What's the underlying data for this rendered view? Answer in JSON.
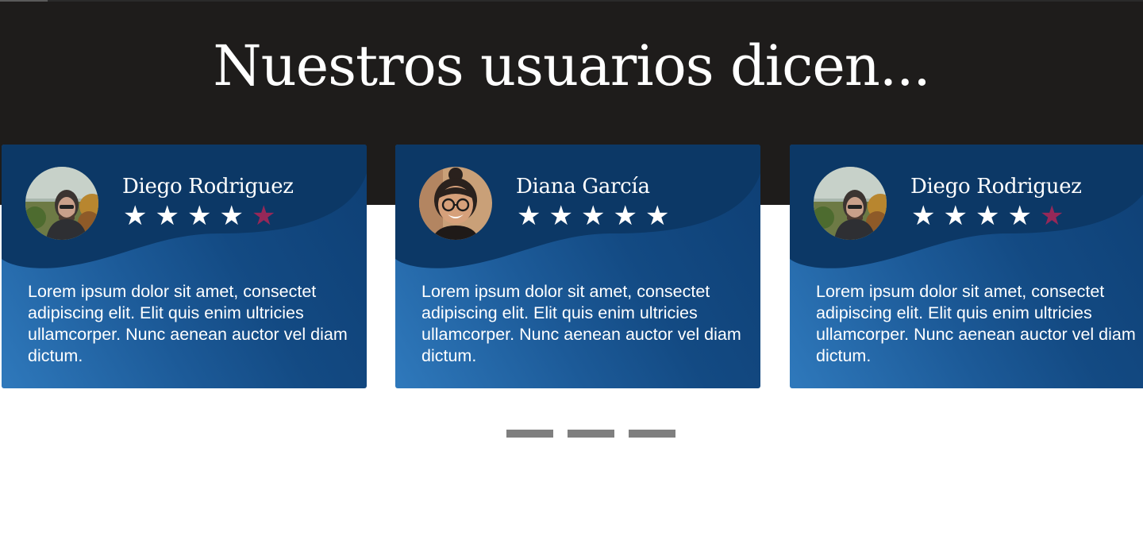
{
  "section": {
    "title": "Nuestros usuarios dicen..."
  },
  "testimonials": [
    {
      "name": "Diego Rodriguez",
      "rating": 4,
      "max_rating": 5,
      "text": "Lorem ipsum dolor sit amet, consectet adipiscing elit. Elit quis enim ultricies ullamcorper. Nunc aenean auctor vel diam dictum."
    },
    {
      "name": "Diana García",
      "rating": 5,
      "max_rating": 5,
      "text": "Lorem ipsum dolor sit amet, consectet adipiscing elit. Elit quis enim ultricies ullamcorper. Nunc aenean auctor vel diam dictum."
    },
    {
      "name": "Diego Rodriguez",
      "rating": 4,
      "max_rating": 5,
      "text": "Lorem ipsum dolor sit amet, consectet adipiscing elit. Elit quis enim ultricies ullamcorper. Nunc aenean auctor vel diam dictum."
    }
  ],
  "pagination": {
    "count": 3
  },
  "colors": {
    "header_background": "#1e1c1b",
    "card_gradient_light": "#2f79bc",
    "card_gradient_dark": "#0e3f74",
    "star_filled": "#ffffff",
    "star_empty": "#962858",
    "pager": "#7f7f7f"
  },
  "icons": {
    "star": "star-icon"
  }
}
